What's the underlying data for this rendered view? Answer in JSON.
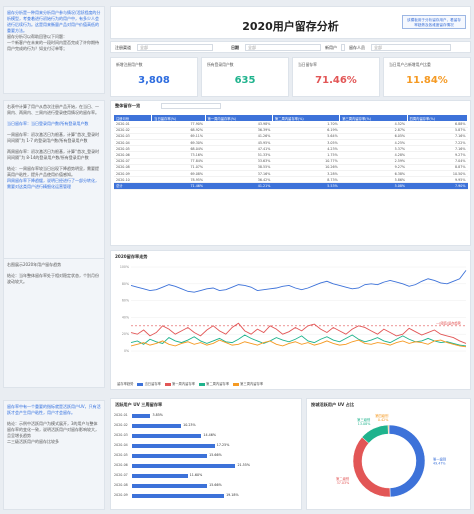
{
  "title": "2020用户留存分析",
  "top_button": "该模板用于分析留存用户，看留存率趋势及各维度留存情况",
  "filters": {
    "channel_label": "注册渠道",
    "channel_value": "全部",
    "date_label": "日期",
    "date_value": "全部",
    "person_label": "新用户",
    "person_value": "全部",
    "type_label": "留存人员",
    "type_value": "全部"
  },
  "left_notes": {
    "p1": "留存分析是一种用来分析用户参与情况/活跃程度的分析模型，考查着进行初始行为的用户中，有多少人会进行后续行为。这是用来衡量产品对用户价值高低的重要方法。",
    "p1b": "留存分析可以帮助回答以下问题：",
    "p1c": "一个新客户在未来的一段时间内是否完成了许你期待用户完成的行为？如支付订单等；",
    "p1d": "某个社交产品改进了新注册用户的引导流程，期待改善用户注册后的参与程度，如何验证？",
    "p1e": "想判断某项产品改动是否奏效，如新增了一个邀请好友的功能，观察是否有人因新增功能而多使用产品几个月？",
    "p2": "右表中计算了用户从首次注册产品开始，在当日、一周内、两周内、三周内进行登录使用情况的留存率。",
    "p2a": "当日留存率：当日登录用户数/所有登录用户数",
    "p2b": "一周留存率：初次激活日为根基，计算“首次_登录时间间隔”为 1-7 的登录用户数/所有登录用户数",
    "p2c": "两周留存率：初次激活日为根基，计算“首次_登录时间间隔”为 8-14的登录用户数/所有登录用户数",
    "p3": "结论：一周留存率较当日出现下降趋势明显，需要提高用户粘性，提升产品使用价值感知。",
    "p3b": "四周留存率下降趋缓，说明已经进行了一部分转化，需要对这类用户进行精细化运营管理",
    "p4": "右图展示2020年用户留存趋势",
    "p4b": "结论：当年整体留存率处于相对稳定状态，个别月份波动较大。",
    "p5": "留存率中有一个重要的指标就是活跃用户UV，只有活跃才会产生用户粘性，用户才会留存。",
    "p5b": "结论：示例中活跃用户为模式展开，3的用户与整体留存率的变化一致，说明活跃用户对留存影响较大，且呈增长趋势",
    "p5c": "二三级活跃用户的留存比较多"
  },
  "kpis": [
    {
      "label": "新增注册用户数",
      "value": "3,808",
      "color": "#2d6cdf"
    },
    {
      "label": "所有登录用户数",
      "value": "635",
      "color": "#1fb38d"
    },
    {
      "label": "当日留存率",
      "value": "71.46%",
      "color": "#e25656"
    },
    {
      "label": "当日用户占新增用户比重",
      "value": "11.84%",
      "color": "#f59a23"
    }
  ],
  "table": {
    "title": "整体留存一览",
    "headers": [
      "注册月份",
      "当日留存率(%)",
      "第一周内留存率(%)",
      "第二周内留存率(%)",
      "第三周内留存率(%)",
      "四周内留存率(%)"
    ],
    "rows": [
      [
        "2020-01",
        "77.90%",
        "43.98%",
        "1.70%",
        "4.52%",
        "6.88%"
      ],
      [
        "2020-02",
        "68.92%",
        "36.39%",
        "6.19%",
        "2.87%",
        "5.87%"
      ],
      [
        "2020-03",
        "69.11%",
        "41.26%",
        "5.64%",
        "6.05%",
        "7.16%"
      ],
      [
        "2020-04",
        "69.30%",
        "45.95%",
        "3.05%",
        "4.25%",
        "7.22%"
      ],
      [
        "2020-05",
        "68.04%",
        "47.41%",
        "4.23%",
        "5.37%",
        "7.16%"
      ],
      [
        "2020-06",
        "73.16%",
        "51.33%",
        "1.75%",
        "4.28%",
        "9.27%"
      ],
      [
        "2020-07",
        "77.84%",
        "33.63%",
        "10.77%",
        "2.59%",
        "7.04%"
      ],
      [
        "2020-08",
        "71.07%",
        "38.55%",
        "10.26%",
        "9.27%",
        "8.87%"
      ],
      [
        "2020-09",
        "69.08%",
        "37.16%",
        "3.28%",
        "6.38%",
        "10.50%"
      ],
      [
        "2020-10",
        "78.95%",
        "36.42%",
        "8.73%",
        "5.86%",
        "9.95%"
      ]
    ],
    "total": [
      "总计",
      "71.46%",
      "41.21%",
      "5.53%",
      "5.08%",
      "7.90%"
    ]
  },
  "line_chart": {
    "title": "2020留存率走势",
    "legend_label": "留存率趋势",
    "legend": [
      "当日留存率",
      "第一周内留存率",
      "第二周内留存率",
      "第三周内留存率"
    ],
    "colors": [
      "#3d72d9",
      "#e25656",
      "#1fb38d",
      "#f59a23"
    ],
    "threshold_label": "—(阈值)留存趋势",
    "y_ticks": [
      "100%",
      "80%",
      "60%",
      "40%",
      "20%",
      "0%"
    ]
  },
  "chart_data": [
    {
      "type": "line",
      "title": "2020留存率走势",
      "xlabel": "",
      "ylabel": "",
      "ylim": [
        0,
        100
      ],
      "series": [
        {
          "name": "当日留存率",
          "values": [
            78,
            76,
            74,
            72,
            73,
            76,
            79,
            77,
            74,
            71,
            70,
            72,
            74,
            75,
            72,
            73,
            76,
            79,
            78,
            76,
            72,
            73,
            74,
            75,
            77,
            78,
            75,
            73,
            75,
            78,
            81,
            83,
            80,
            78,
            76,
            74,
            75,
            79,
            80,
            79,
            82,
            84,
            82,
            80,
            77,
            79,
            83,
            86,
            84,
            81,
            80,
            83,
            86,
            96
          ]
        },
        {
          "name": "第一周内留存率",
          "values": [
            22,
            20,
            25,
            18,
            22,
            30,
            26,
            20,
            24,
            28,
            22,
            18,
            25,
            30,
            24,
            20,
            28,
            33,
            24,
            20,
            26,
            22,
            30,
            26,
            20,
            23,
            28,
            24,
            30,
            32,
            26,
            22,
            28,
            24,
            20,
            26,
            30,
            28,
            24,
            20,
            26,
            22,
            18,
            20,
            27,
            23,
            19,
            22,
            25,
            20,
            18,
            16,
            12,
            9
          ]
        },
        {
          "name": "第二周内留存率",
          "values": [
            10,
            12,
            8,
            14,
            11,
            9,
            16,
            12,
            10,
            13,
            17,
            12,
            9,
            12,
            15,
            11,
            10,
            14,
            19,
            15,
            12,
            9,
            12,
            16,
            13,
            11,
            14,
            18,
            12,
            10,
            14,
            17,
            13,
            11,
            15,
            19,
            14,
            11,
            13,
            16,
            12,
            10,
            14,
            18,
            14,
            11,
            12,
            15,
            12,
            10,
            11,
            9,
            7,
            6
          ]
        },
        {
          "name": "第三周内留存率",
          "values": [
            6,
            8,
            10,
            7,
            9,
            12,
            8,
            6,
            9,
            11,
            8,
            10,
            7,
            9,
            13,
            10,
            7,
            8,
            11,
            9,
            7,
            10,
            12,
            8,
            6,
            9,
            11,
            8,
            10,
            7,
            9,
            12,
            9,
            7,
            8,
            11,
            13,
            9,
            8,
            10,
            9,
            7,
            10,
            12,
            9,
            11,
            10,
            8,
            12,
            13,
            10,
            8,
            6,
            5
          ]
        }
      ],
      "threshold": 30
    },
    {
      "type": "bar",
      "title": "活跃用户 UV 三周留存率",
      "categories": [
        "2020-01",
        "2020-02",
        "2020-03",
        "2020-04",
        "2020-05",
        "2020-06",
        "2020-07",
        "2020-08",
        "2020-09"
      ],
      "values": [
        3.85,
        10.23,
        14.46,
        17.25,
        15.66,
        21.55,
        11.6,
        15.66,
        19.18
      ],
      "labels": [
        "3.85%",
        "10.23%",
        "14.46%",
        "17.25%",
        "15.66%",
        "21.55%",
        "11.60%",
        "15.66%",
        "19.18%"
      ],
      "xlim": [
        0,
        25
      ]
    },
    {
      "type": "pie",
      "title": "按城活跃用户 UV 占比",
      "categories": [
        "第一级别",
        "第二级别",
        "第三级别",
        "第四级别"
      ],
      "values": [
        49.47,
        37.03,
        13.08,
        0.42
      ],
      "labels": [
        "第一级别\n49.47%",
        "第二级别\n37.03%",
        "第三级别\n13.08%",
        "第四级别\n0.42%"
      ],
      "colors": [
        "#3d72d9",
        "#e25656",
        "#1fb38d",
        "#f59a23"
      ]
    }
  ],
  "bar_panel": {
    "title": "活跃用户 UV 三周留存率"
  },
  "pie_panel": {
    "title": "按城活跃用户 UV 占比"
  }
}
